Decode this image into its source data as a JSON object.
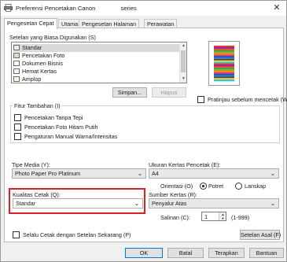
{
  "window": {
    "title": "Preferensi Pencetakan Canon",
    "title_suffix": "series",
    "close_glyph": "✕"
  },
  "tabs": [
    {
      "label": "Pengesetan Cepat",
      "active": true
    },
    {
      "label": "Utama",
      "active": false
    },
    {
      "label": "Pengesetan Halaman",
      "active": false
    },
    {
      "label": "Perawatan",
      "active": false
    }
  ],
  "common_settings": {
    "label": "Setelan yang Biasa Digunakan (S)",
    "items": [
      "Standar",
      "Pencetakan Foto",
      "Dokumen Bisnis",
      "Hemat Kertas",
      "Amplop"
    ],
    "selected_index": 0,
    "save_button": "Simpan...",
    "delete_button": "Hapus"
  },
  "preview": {
    "checkbox_label": "Pratinjau sebelum mencetak (W)",
    "checked": false,
    "colors": [
      "#e53935",
      "#fb8c00",
      "#fdd835",
      "#43a047",
      "#1e88e5",
      "#8e24aa",
      "#ec407a",
      "#26c6da",
      "#7cb342",
      "#5d4037",
      "#f4511e",
      "#3949ab"
    ]
  },
  "extra_features": {
    "label": "Fitur Tambahan (I)",
    "options": [
      {
        "label": "Pencetakan Tanpa Tepi",
        "checked": false
      },
      {
        "label": "Pencetakan Foto Hitam Putih",
        "checked": false
      },
      {
        "label": "Pengaturan Manual Warna/Intensitas",
        "checked": false
      }
    ]
  },
  "media_type": {
    "label": "Tipe Media (Y):",
    "value": "Photo Paper Pro Platinum"
  },
  "paper_size": {
    "label": "Ukuran Kertas Pencetak (E):",
    "value": "A4"
  },
  "orientation": {
    "label": "Orientasi (O)",
    "portrait": "Potret",
    "landscape": "Lanskap",
    "selected": "portrait"
  },
  "print_quality": {
    "label": "Kualitas Cetak (Q):",
    "value": "Standar"
  },
  "paper_source": {
    "label": "Sumber Kertas (R):",
    "value": "Penyalur Atas"
  },
  "copies": {
    "label": "Salinan (C):",
    "value": "1",
    "range": "(1-999)"
  },
  "always_print": {
    "label": "Selalu Cetak dengan Setelan Sekarang (P)",
    "checked": false
  },
  "defaults_button": "Setelan Asal (F)",
  "footer": {
    "ok": "OK",
    "cancel": "Batal",
    "apply": "Terapkan",
    "help": "Bantuan"
  },
  "colors": {
    "highlight": "#e02020",
    "focus": "#0078d7"
  }
}
